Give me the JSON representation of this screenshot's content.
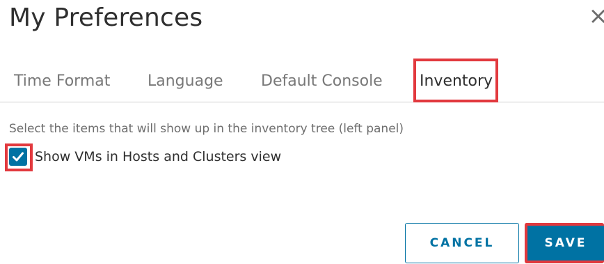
{
  "dialog": {
    "title": "My Preferences",
    "close_icon": "×"
  },
  "tabs": [
    {
      "label": "Time Format",
      "active": false
    },
    {
      "label": "Language",
      "active": false
    },
    {
      "label": "Default Console",
      "active": false
    },
    {
      "label": "Inventory",
      "active": true
    }
  ],
  "inventory": {
    "instruction": "Select the items that will show up in the inventory tree (left panel)",
    "option": {
      "label": "Show VMs in Hosts and Clusters view",
      "checked": true
    }
  },
  "buttons": {
    "cancel": "CANCEL",
    "save": "SAVE"
  },
  "colors": {
    "accent": "#0072a3",
    "highlight": "#e2393e"
  }
}
